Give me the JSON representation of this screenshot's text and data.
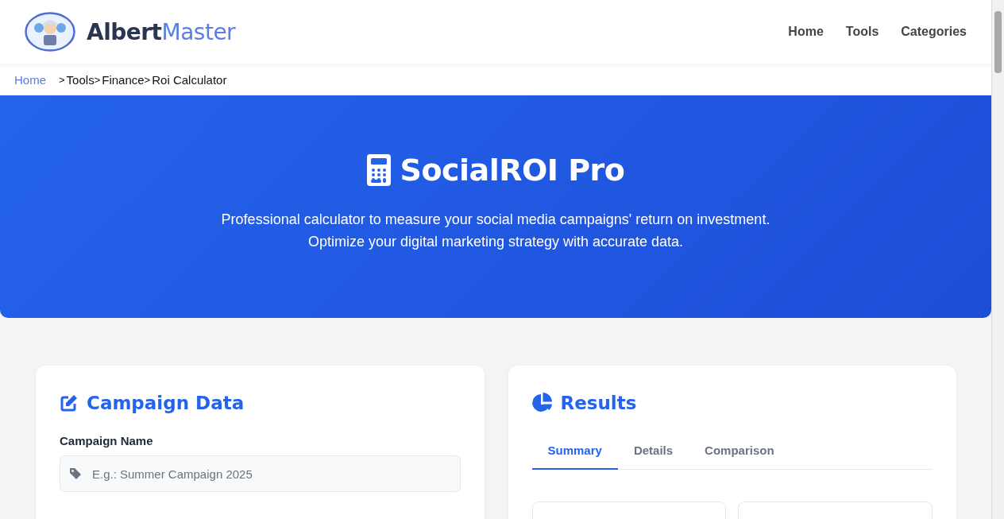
{
  "header": {
    "brand_first": "Albert",
    "brand_second": "Master",
    "nav": [
      {
        "label": "Home"
      },
      {
        "label": "Tools"
      },
      {
        "label": "Categories"
      }
    ]
  },
  "breadcrumb": [
    {
      "label": "Home",
      "kind": "link"
    },
    {
      "separator": ">",
      "label": "Tools",
      "kind": "current"
    },
    {
      "separator": ">",
      "label": "Finance",
      "kind": "current"
    },
    {
      "separator": ">",
      "label": "Roi Calculator",
      "kind": "current"
    }
  ],
  "hero": {
    "title": "SocialROI Pro",
    "description": [
      "Professional calculator to measure your social media campaigns' return on investment.",
      "Optimize your digital marketing strategy with accurate data."
    ]
  },
  "campaign_card": {
    "title": "Campaign Data",
    "fields": [
      {
        "label": "Campaign Name",
        "placeholder": "E.g.: Summer Campaign 2025"
      }
    ]
  },
  "results_card": {
    "title": "Results",
    "tabs": [
      {
        "label": "Summary",
        "selected": true
      },
      {
        "label": "Details",
        "selected": false
      },
      {
        "label": "Comparison",
        "selected": false
      }
    ]
  }
}
